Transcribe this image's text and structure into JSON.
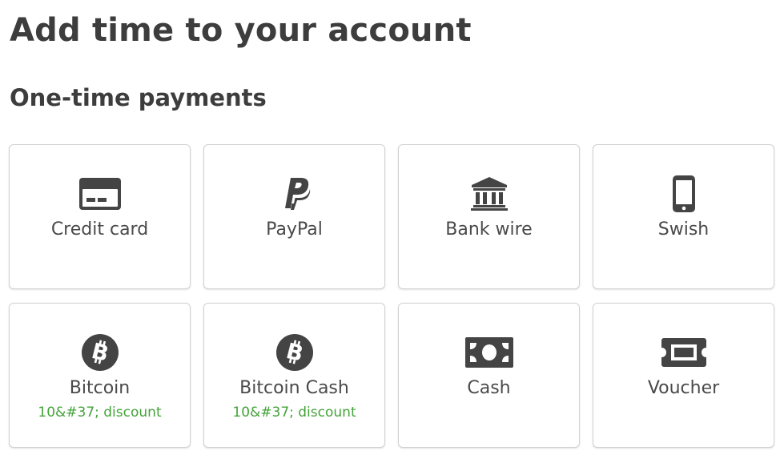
{
  "page": {
    "title": "Add time to your account",
    "section_title": "One-time payments"
  },
  "colors": {
    "text": "#3d3d3d",
    "icon": "#444444",
    "discount": "#44a339",
    "border": "#d2d2d2"
  },
  "payment_methods": [
    {
      "label": "Credit card",
      "icon": "credit-card-icon"
    },
    {
      "label": "PayPal",
      "icon": "paypal-icon"
    },
    {
      "label": "Bank wire",
      "icon": "bank-icon"
    },
    {
      "label": "Swish",
      "icon": "mobile-phone-icon"
    },
    {
      "label": "Bitcoin",
      "icon": "bitcoin-icon",
      "discount": "10&#37; discount"
    },
    {
      "label": "Bitcoin Cash",
      "icon": "bitcoin-icon",
      "discount": "10&#37; discount"
    },
    {
      "label": "Cash",
      "icon": "banknote-icon"
    },
    {
      "label": "Voucher",
      "icon": "voucher-ticket-icon"
    }
  ]
}
